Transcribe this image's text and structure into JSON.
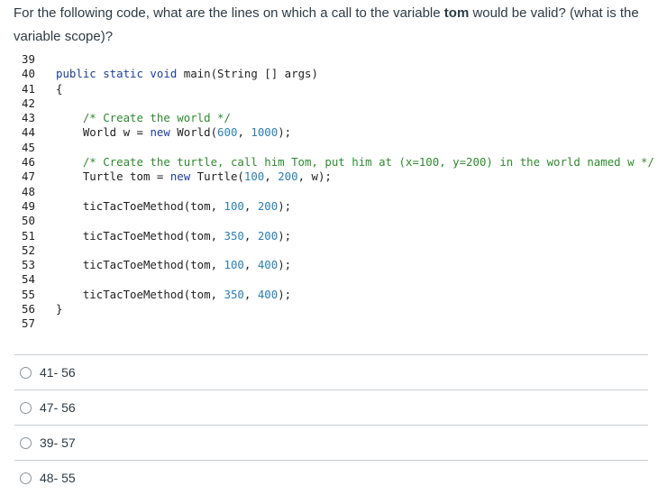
{
  "question": {
    "text_before": "For the following code, what are the lines on which a call to the variable ",
    "variable": "tom",
    "text_after": " would be valid? (what is the variable scope)?"
  },
  "code": {
    "lines": [
      {
        "n": "39",
        "parts": []
      },
      {
        "n": "40",
        "parts": [
          {
            "t": "kw",
            "s": "public static void "
          },
          {
            "t": "plain",
            "s": "main(String [] args)"
          }
        ]
      },
      {
        "n": "41",
        "parts": [
          {
            "t": "plain",
            "s": "{"
          }
        ]
      },
      {
        "n": "42",
        "parts": []
      },
      {
        "n": "43",
        "parts": [
          {
            "t": "cm",
            "s": "    /* Create the world */"
          }
        ]
      },
      {
        "n": "44",
        "parts": [
          {
            "t": "plain",
            "s": "    World w = "
          },
          {
            "t": "kw",
            "s": "new "
          },
          {
            "t": "plain",
            "s": "World("
          },
          {
            "t": "num",
            "s": "600"
          },
          {
            "t": "plain",
            "s": ", "
          },
          {
            "t": "num",
            "s": "1000"
          },
          {
            "t": "plain",
            "s": ");"
          }
        ]
      },
      {
        "n": "45",
        "parts": []
      },
      {
        "n": "46",
        "parts": [
          {
            "t": "cm",
            "s": "    /* Create the turtle, call him Tom, put him at (x=100, y=200) in the world named w */"
          }
        ]
      },
      {
        "n": "47",
        "parts": [
          {
            "t": "plain",
            "s": "    Turtle tom = "
          },
          {
            "t": "kw",
            "s": "new "
          },
          {
            "t": "plain",
            "s": "Turtle("
          },
          {
            "t": "num",
            "s": "100"
          },
          {
            "t": "plain",
            "s": ", "
          },
          {
            "t": "num",
            "s": "200"
          },
          {
            "t": "plain",
            "s": ", w);"
          }
        ]
      },
      {
        "n": "48",
        "parts": []
      },
      {
        "n": "49",
        "parts": [
          {
            "t": "plain",
            "s": "    ticTacToeMethod(tom, "
          },
          {
            "t": "num",
            "s": "100"
          },
          {
            "t": "plain",
            "s": ", "
          },
          {
            "t": "num",
            "s": "200"
          },
          {
            "t": "plain",
            "s": ");"
          }
        ]
      },
      {
        "n": "50",
        "parts": []
      },
      {
        "n": "51",
        "parts": [
          {
            "t": "plain",
            "s": "    ticTacToeMethod(tom, "
          },
          {
            "t": "num",
            "s": "350"
          },
          {
            "t": "plain",
            "s": ", "
          },
          {
            "t": "num",
            "s": "200"
          },
          {
            "t": "plain",
            "s": ");"
          }
        ]
      },
      {
        "n": "52",
        "parts": []
      },
      {
        "n": "53",
        "parts": [
          {
            "t": "plain",
            "s": "    ticTacToeMethod(tom, "
          },
          {
            "t": "num",
            "s": "100"
          },
          {
            "t": "plain",
            "s": ", "
          },
          {
            "t": "num",
            "s": "400"
          },
          {
            "t": "plain",
            "s": ");"
          }
        ]
      },
      {
        "n": "54",
        "parts": []
      },
      {
        "n": "55",
        "parts": [
          {
            "t": "plain",
            "s": "    ticTacToeMethod(tom, "
          },
          {
            "t": "num",
            "s": "350"
          },
          {
            "t": "plain",
            "s": ", "
          },
          {
            "t": "num",
            "s": "400"
          },
          {
            "t": "plain",
            "s": ");"
          }
        ]
      },
      {
        "n": "56",
        "parts": [
          {
            "t": "plain",
            "s": "}"
          }
        ]
      },
      {
        "n": "57",
        "parts": []
      }
    ]
  },
  "answers": [
    {
      "label": "41- 56"
    },
    {
      "label": "47- 56"
    },
    {
      "label": "39- 57"
    },
    {
      "label": "48- 55"
    }
  ]
}
